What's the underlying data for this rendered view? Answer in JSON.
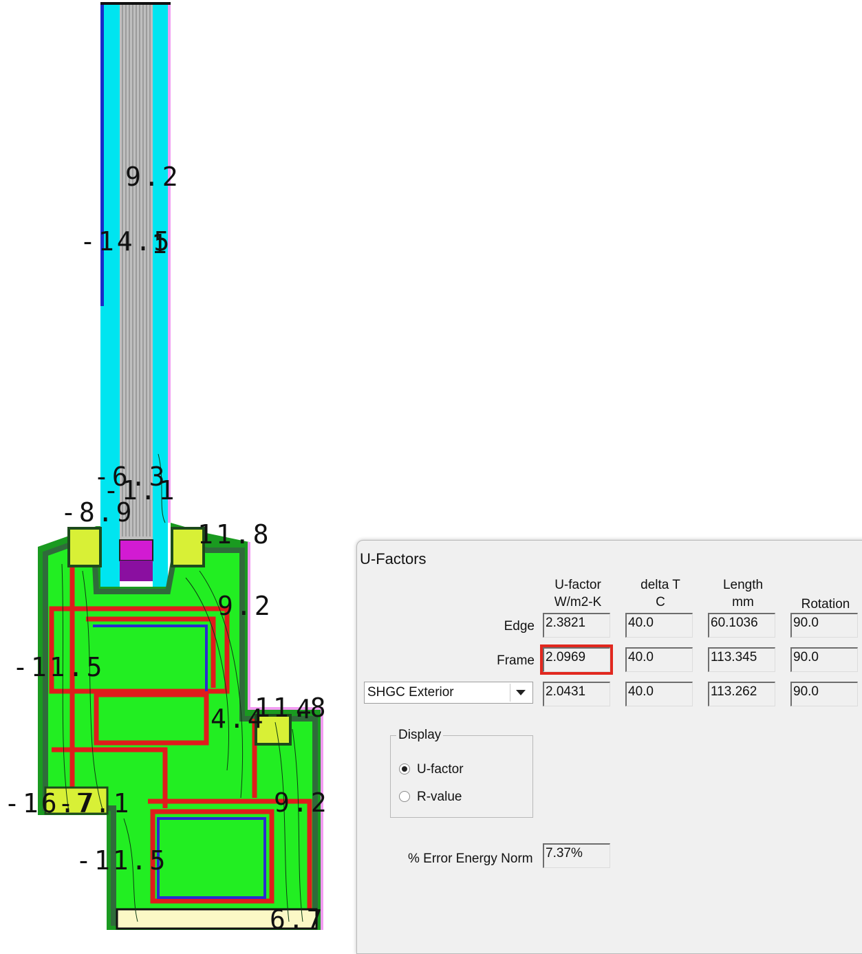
{
  "drawing": {
    "contour_labels": [
      "9.2",
      "-14.5",
      "1",
      "-6.3",
      "-1.1",
      "-8.9",
      "11.8",
      "9.2",
      "-11.5",
      "4.4",
      "11.8",
      "4",
      "-16.7",
      "-7.1",
      "9.2",
      "-11.5",
      "6.7"
    ]
  },
  "dialog": {
    "title": "U-Factors",
    "columns": {
      "ufactor": [
        "U-factor",
        "W/m2-K"
      ],
      "deltaT": [
        "delta T",
        "C"
      ],
      "length": [
        "Length",
        "mm"
      ],
      "rotation": [
        "Rotation"
      ]
    },
    "rows": [
      {
        "label": "Edge",
        "ufactor": "2.3821",
        "deltaT": "40.0",
        "length": "60.1036",
        "rotation": "90.0"
      },
      {
        "label": "Frame",
        "ufactor": "2.0969",
        "deltaT": "40.0",
        "length": "113.345",
        "rotation": "90.0"
      },
      {
        "label": "SHGC Exterior",
        "ufactor": "2.0431",
        "deltaT": "40.0",
        "length": "113.262",
        "rotation": "90.0"
      }
    ],
    "display": {
      "legend": "Display",
      "options": [
        "U-factor",
        "R-value"
      ],
      "selected": "U-factor"
    },
    "error": {
      "label": "% Error Energy Norm",
      "value": "7.37%"
    }
  }
}
